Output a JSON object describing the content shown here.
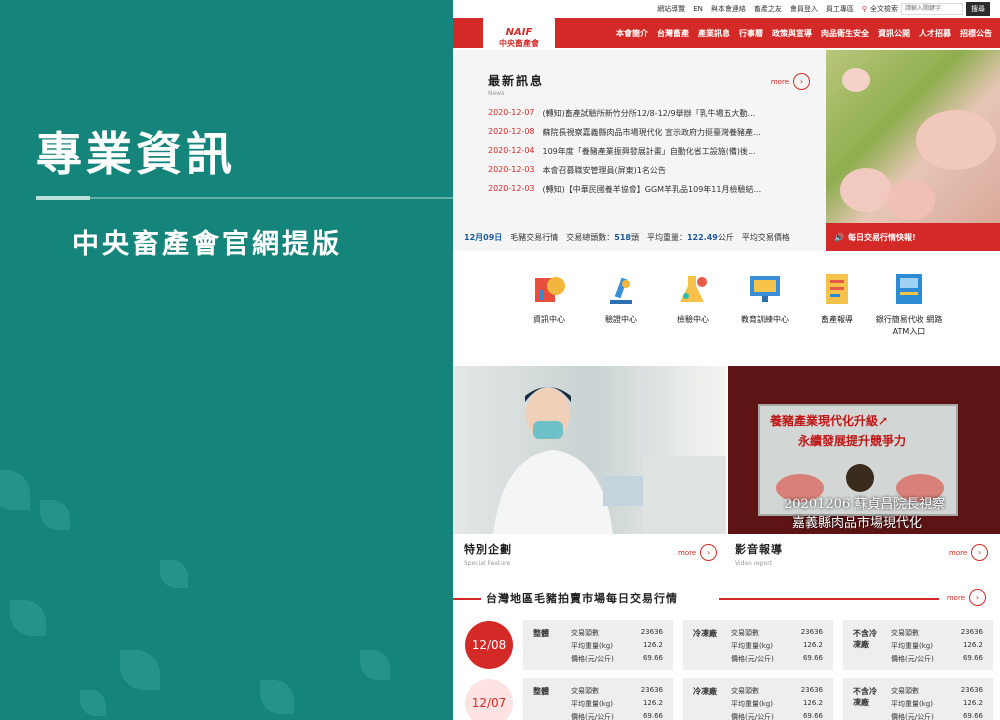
{
  "left": {
    "title": "專業資訊",
    "subtitle": "中央畜產會官網提版"
  },
  "site": {
    "topbar": [
      "網站導覽",
      "EN",
      "與本會連絡",
      "畜產之友",
      "會員登入",
      "員工專區"
    ],
    "search_label": "全文檢索",
    "search_placeholder": "請輸入關鍵字",
    "search_button": "搜尋",
    "logo_en": "NAIF",
    "logo_zh": "中央畜產會",
    "nav": [
      "本會簡介",
      "台灣畜產",
      "產業訊息",
      "行事曆",
      "政策與宣導",
      "肉品衛生安全",
      "資訊公開",
      "人才招募",
      "招標公告"
    ],
    "news": {
      "title": "最新訊息",
      "subtitle": "News",
      "more": "more",
      "items": [
        {
          "date": "2020-12-07",
          "text": "(轉知)畜產試驗所新竹分所12/8-12/9舉辦「乳牛場五大動..."
        },
        {
          "date": "2020-12-08",
          "text": "蘇院長視察嘉義縣肉品市場現代化 宣示政府力挺臺灣養豬產..."
        },
        {
          "date": "2020-12-04",
          "text": "109年度「養豬產業振興發展計畫」自動化省工設施(備)後..."
        },
        {
          "date": "2020-12-03",
          "text": "本會召募職安管理員(屏東)1名公告"
        },
        {
          "date": "2020-12-03",
          "text": "(轉知)【中華民國養羊協會】GGM羊乳品109年11月檢驗結..."
        }
      ]
    },
    "ticker": {
      "date": "12月09日",
      "label": "毛豬交易行情",
      "count_label": "交易總頭數：",
      "count": "518",
      "count_unit": "頭",
      "weight_label": "平均重量：",
      "weight": "122.49",
      "weight_unit": "公斤",
      "price_label": "平均交易價格"
    },
    "ticker_button": "每日交易行情快報!",
    "icons": [
      {
        "label": "資訊中心"
      },
      {
        "label": "驗證中心"
      },
      {
        "label": "檢驗中心"
      },
      {
        "label": "教育訓練中心"
      },
      {
        "label": "畜產報導"
      },
      {
        "label": "銀行簡易代收 網路ATM入口"
      }
    ],
    "video": {
      "sign1": "養豬產業現代化升級↗",
      "sign2": "永續發展提升競爭力",
      "cap1": "20201206 蘇貞昌院長視察",
      "cap2": "嘉義縣肉品市場現代化"
    },
    "feature": {
      "title": "特別企劃",
      "en": "Special Feature",
      "more": "more"
    },
    "media": {
      "title": "影音報導",
      "en": "Video report",
      "more": "more"
    },
    "market": {
      "title": "台灣地區毛豬拍賣市場每日交易行情",
      "more": "more",
      "rows": [
        {
          "date": "12/08",
          "cards": [
            {
              "name": "整體",
              "items": [
                [
                  "交易頭數",
                  "23636"
                ],
                [
                  "平均重量(kg)",
                  "126.2"
                ],
                [
                  "價格(元/公斤)",
                  "69.66"
                ]
              ]
            },
            {
              "name": "冷凍廠",
              "items": [
                [
                  "交易頭數",
                  "23636"
                ],
                [
                  "平均重量(kg)",
                  "126.2"
                ],
                [
                  "價格(元/公斤)",
                  "69.66"
                ]
              ]
            },
            {
              "name": "不含冷凍廠",
              "items": [
                [
                  "交易頭數",
                  "23636"
                ],
                [
                  "平均重量(kg)",
                  "126.2"
                ],
                [
                  "價格(元/公斤)",
                  "69.66"
                ]
              ]
            }
          ]
        },
        {
          "date": "12/07",
          "cards": [
            {
              "name": "整體",
              "items": [
                [
                  "交易頭數",
                  "23636"
                ],
                [
                  "平均重量(kg)",
                  "126.2"
                ],
                [
                  "價格(元/公斤)",
                  "69.66"
                ]
              ]
            },
            {
              "name": "冷凍廠",
              "items": [
                [
                  "交易頭數",
                  "23636"
                ],
                [
                  "平均重量(kg)",
                  "126.2"
                ],
                [
                  "價格(元/公斤)",
                  "69.66"
                ]
              ]
            },
            {
              "name": "不含冷凍廠",
              "items": [
                [
                  "交易頭數",
                  "23636"
                ],
                [
                  "平均重量(kg)",
                  "126.2"
                ],
                [
                  "價格(元/公斤)",
                  "69.66"
                ]
              ]
            }
          ]
        }
      ]
    }
  },
  "colors": {
    "brand_red": "#d42a27",
    "teal": "#15847a"
  }
}
